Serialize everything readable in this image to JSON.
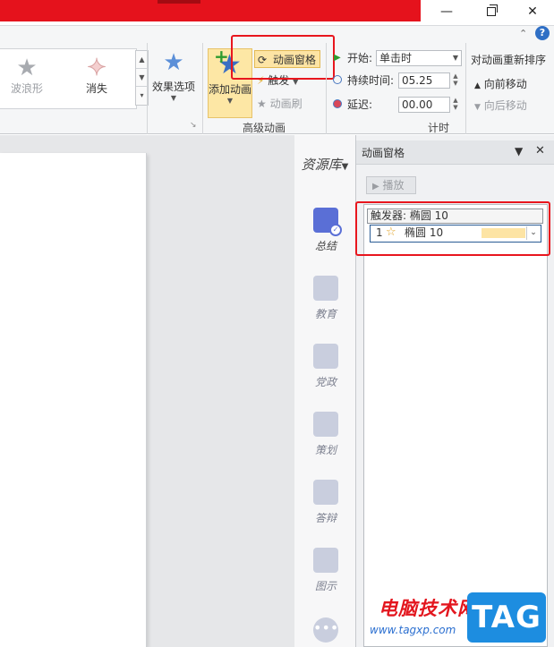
{
  "window": {
    "minimize": "—",
    "restore": "",
    "close": "✕"
  },
  "ribbon": {
    "gallery": {
      "items": [
        {
          "label": "波浪形",
          "icon": "wave-star-icon"
        },
        {
          "label": "消失",
          "icon": "disappear-star-icon"
        }
      ]
    },
    "effect_options": "效果选项",
    "add_animation": "添加动画",
    "animation_pane": "动画窗格",
    "trigger": "触发",
    "animation_painter": "动画刷",
    "advanced_group": "高级动画",
    "timing": {
      "start_label": "开始:",
      "start_value": "单击时",
      "duration_label": "持续时间:",
      "duration_value": "05.25",
      "delay_label": "延迟:",
      "delay_value": "00.00",
      "group": "计时"
    },
    "reorder": {
      "title": "对动画重新排序",
      "move_earlier": "向前移动",
      "move_later": "向后移动"
    }
  },
  "resource_library": {
    "title": "资源库",
    "items": [
      {
        "label": "总结",
        "icon": "summary-icon"
      },
      {
        "label": "教育",
        "icon": "education-icon"
      },
      {
        "label": "党政",
        "icon": "government-icon"
      },
      {
        "label": "策划",
        "icon": "planning-icon"
      },
      {
        "label": "答辩",
        "icon": "defense-icon"
      },
      {
        "label": "图示",
        "icon": "diagram-icon"
      }
    ]
  },
  "animation_pane": {
    "title": "动画窗格",
    "play": "播放",
    "trigger_header": "触发器: 椭圆 10",
    "items": [
      {
        "index": "1",
        "name": "椭圆 10"
      }
    ]
  },
  "watermark": {
    "site_name": "电脑技术网",
    "url": "www.tagxp.com",
    "tag": "TAG"
  },
  "colors": {
    "title_red": "#e5121c",
    "highlight_red": "#e8161e",
    "selected_fill": "#fde4a4",
    "tag_blue": "#1d8de0"
  }
}
